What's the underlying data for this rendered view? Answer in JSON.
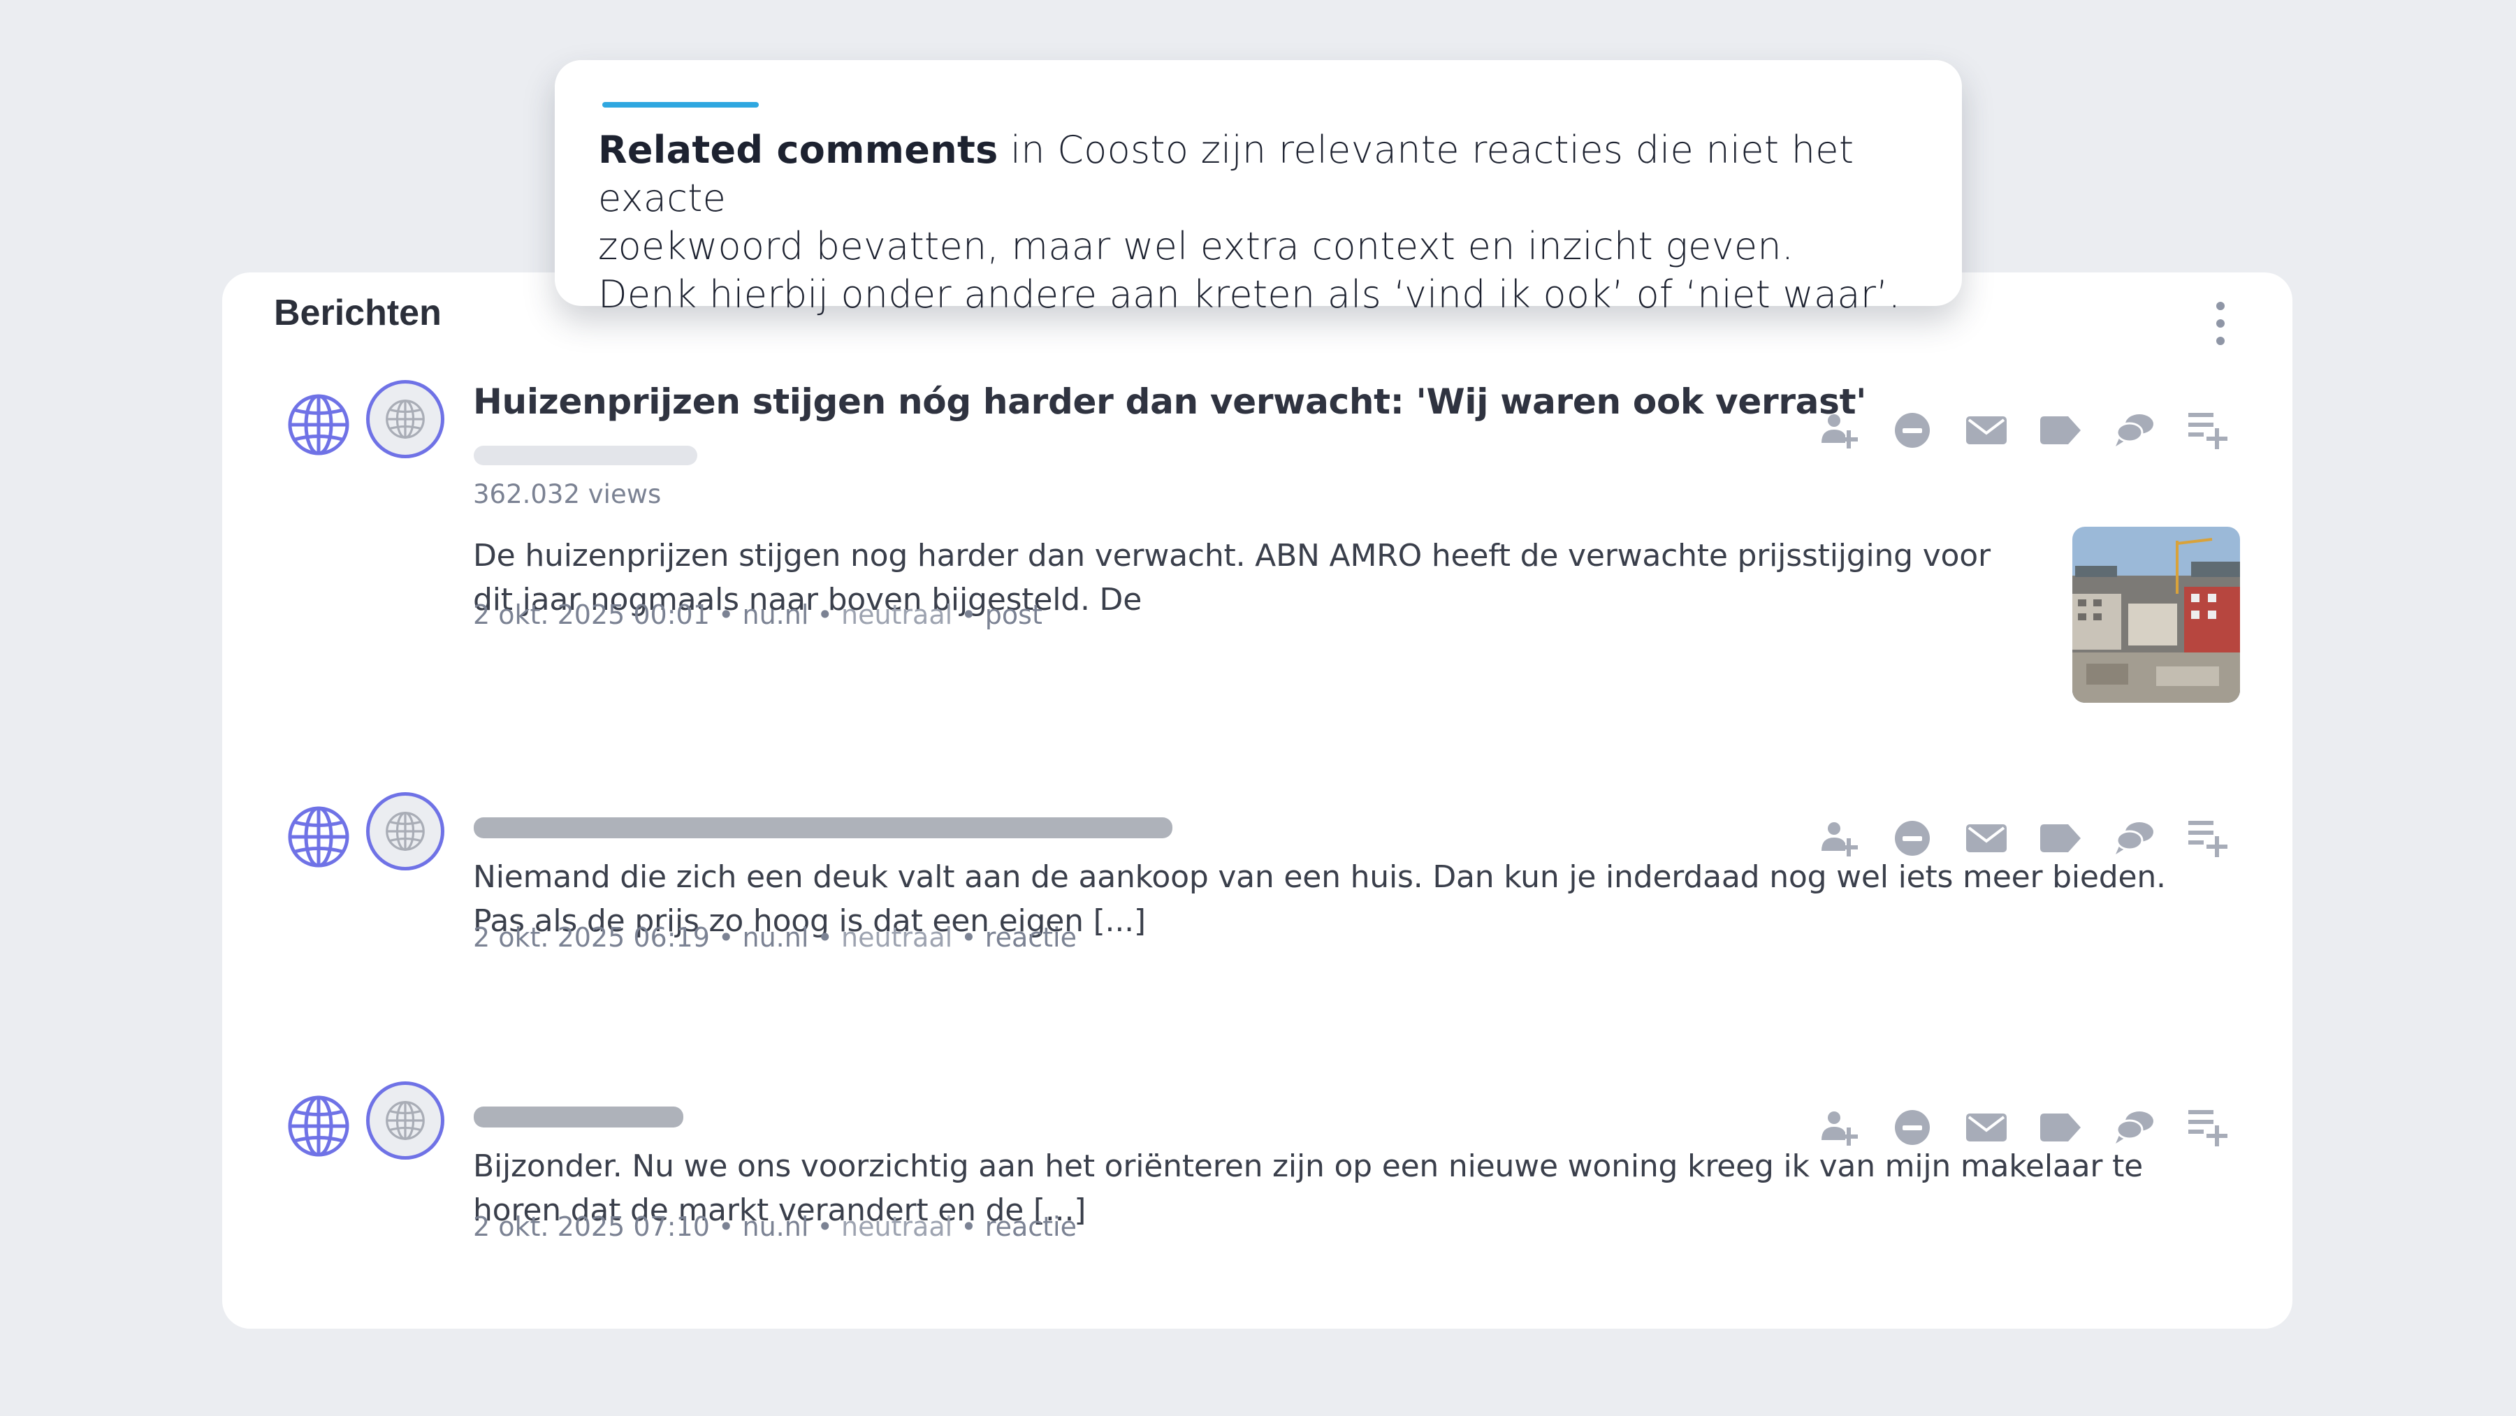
{
  "callout": {
    "bold": "Related comments",
    "line1_rest": " in Coosto zijn relevante reacties die niet het exacte",
    "line2": "zoekwoord bevatten, maar wel extra context en inzicht geven.",
    "line3": "Denk hierbij onder andere aan kreten als ‘vind ik ook’ of ‘niet waar’."
  },
  "panel": {
    "title": "Berichten"
  },
  "posts": [
    {
      "title": "Huizenprijzen stijgen nóg harder dan verwacht: 'Wij waren ook verrast'",
      "views": "362.032 views",
      "body": "De huizenprijzen stijgen nog harder dan verwacht. ABN AMRO heeft de verwachte prijsstijging voor dit jaar nogmaals naar boven bijgesteld. De",
      "date": "2 okt. 2025 00:01",
      "source": "nu.nl",
      "sentiment": "neutraal",
      "type": "post"
    },
    {
      "body": "Niemand die zich een deuk valt aan de aankoop van een huis. Dan kun je inderdaad nog wel iets meer bieden. Pas als de prijs zo hoog is dat een eigen [...]",
      "date": "2 okt. 2025 06:19",
      "source": "nu.nl",
      "sentiment": "neutraal",
      "type": "reactie"
    },
    {
      "body": "Bijzonder. Nu we ons voorzichtig aan het oriënteren zijn op een nieuwe woning kreeg ik van mijn makelaar te horen dat de markt verandert en de [...]",
      "date": "2 okt. 2025 07:10",
      "source": "nu.nl",
      "sentiment": "neutraal",
      "type": "reactie"
    }
  ],
  "separator": "•",
  "icons": {
    "actions": [
      "add-person-icon",
      "minus-circle-icon",
      "mail-icon",
      "tag-icon",
      "chat-bubbles-icon",
      "add-to-list-icon"
    ],
    "source": "globe-icon",
    "avatar": "globe-icon"
  },
  "colors": {
    "background": "#ebedf1",
    "accent": "#2fa7e0",
    "globe": "#6f72e6",
    "action_icon": "#a7acb8",
    "skeleton": "#aeb2ba"
  }
}
